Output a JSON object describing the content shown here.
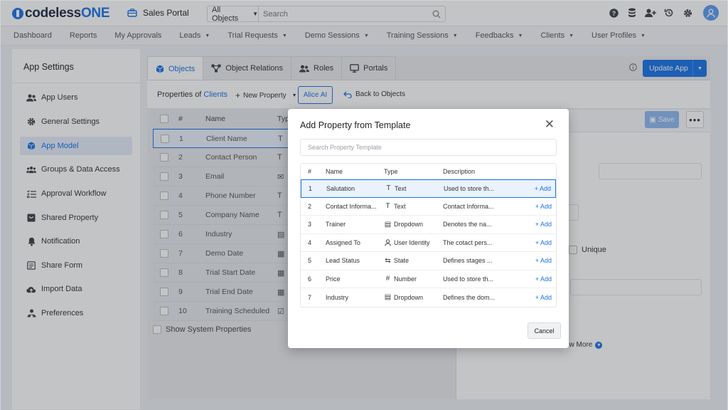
{
  "app": {
    "logo_main": "codeless",
    "logo_accent": "ONE",
    "portal_name": "Sales Portal"
  },
  "search": {
    "scope": "All Objects",
    "placeholder": "Search"
  },
  "top_icons": [
    "help-icon",
    "database-icon",
    "add-user-icon",
    "history-icon",
    "settings-icon",
    "user-avatar-icon"
  ],
  "nav": [
    {
      "label": "Dashboard",
      "dropdown": false
    },
    {
      "label": "Reports",
      "dropdown": false
    },
    {
      "label": "My Approvals",
      "dropdown": false
    },
    {
      "label": "Leads",
      "dropdown": true
    },
    {
      "label": "Trial Requests",
      "dropdown": true
    },
    {
      "label": "Demo Sessions",
      "dropdown": true
    },
    {
      "label": "Training Sessions",
      "dropdown": true
    },
    {
      "label": "Feedbacks",
      "dropdown": true
    },
    {
      "label": "Clients",
      "dropdown": true
    },
    {
      "label": "User Profiles",
      "dropdown": true
    }
  ],
  "sidebar": {
    "title": "App Settings",
    "items": [
      {
        "label": "App Users",
        "icon": "users-icon"
      },
      {
        "label": "General Settings",
        "icon": "gear-icon"
      },
      {
        "label": "App Model",
        "icon": "cube-icon",
        "active": true
      },
      {
        "label": "Groups & Data Access",
        "icon": "group-icon"
      },
      {
        "label": "Approval Workflow",
        "icon": "checklist-icon"
      },
      {
        "label": "Shared Property",
        "icon": "shared-box-icon"
      },
      {
        "label": "Notification",
        "icon": "bell-icon"
      },
      {
        "label": "Share Form",
        "icon": "form-icon"
      },
      {
        "label": "Import Data",
        "icon": "cloud-upload-icon"
      },
      {
        "label": "Preferences",
        "icon": "preferences-icon"
      }
    ]
  },
  "tabs": [
    {
      "label": "Objects",
      "icon": "cube-icon",
      "active": true
    },
    {
      "label": "Object Relations",
      "icon": "relations-icon"
    },
    {
      "label": "Roles",
      "icon": "roles-icon"
    },
    {
      "label": "Portals",
      "icon": "monitor-icon"
    }
  ],
  "toolbar": {
    "update_label": "Update App",
    "properties_of": "Properties of",
    "object_name": "Clients",
    "new_property": "New Property",
    "alice_ai": "Alice AI",
    "back_to_objects": "Back to Objects"
  },
  "property_table": {
    "columns": [
      "#",
      "Name",
      "Type"
    ],
    "rows": [
      {
        "num": "1",
        "name": "Client Name",
        "type_icon": "T"
      },
      {
        "num": "2",
        "name": "Contact Person",
        "type_icon": "T"
      },
      {
        "num": "3",
        "name": "Email",
        "type_icon": "✉"
      },
      {
        "num": "4",
        "name": "Phone Number",
        "type_icon": "T"
      },
      {
        "num": "5",
        "name": "Company Name",
        "type_icon": "T"
      },
      {
        "num": "6",
        "name": "Industry",
        "type_icon": "▤"
      },
      {
        "num": "7",
        "name": "Demo Date",
        "type_icon": "▦"
      },
      {
        "num": "8",
        "name": "Trial Start Date",
        "type_icon": "▦"
      },
      {
        "num": "9",
        "name": "Trial End Date",
        "type_icon": "▦"
      },
      {
        "num": "10",
        "name": "Training Scheduled",
        "type_icon": "☑"
      }
    ],
    "show_system": "Show System Properties"
  },
  "detail_panel": {
    "save_label": "Save",
    "more_label": "•••",
    "unique_label": "Unique",
    "show_more_label": "ow More"
  },
  "modal": {
    "title": "Add Property from Template",
    "close": "✕",
    "search_placeholder": "Search Property Template",
    "columns": [
      "#",
      "Name",
      "Type",
      "Description"
    ],
    "rows": [
      {
        "num": "1",
        "name": "Salutation",
        "type_icon": "T",
        "type": "Text",
        "description": "Used to store th...",
        "action": "+ Add"
      },
      {
        "num": "2",
        "name": "Contact Informa...",
        "type_icon": "T",
        "type": "Text",
        "description": "Contact Informa...",
        "action": "+ Add"
      },
      {
        "num": "3",
        "name": "Trainer",
        "type_icon": "▤",
        "type": "Dropdown",
        "description": "Denotes the na...",
        "action": "+ Add"
      },
      {
        "num": "4",
        "name": "Assigned To",
        "type_icon": "👤",
        "type": "User Identity",
        "description": "The cotact pers...",
        "action": "+ Add"
      },
      {
        "num": "5",
        "name": "Lead Status",
        "type_icon": "⇆",
        "type": "State",
        "description": "Defines stages ...",
        "action": "+ Add"
      },
      {
        "num": "6",
        "name": "Price",
        "type_icon": "#",
        "type": "Number",
        "description": "Used to store th...",
        "action": "+ Add"
      },
      {
        "num": "7",
        "name": "Industry",
        "type_icon": "▤",
        "type": "Dropdown",
        "description": "Defines the dom...",
        "action": "+ Add"
      }
    ],
    "cancel_label": "Cancel"
  }
}
